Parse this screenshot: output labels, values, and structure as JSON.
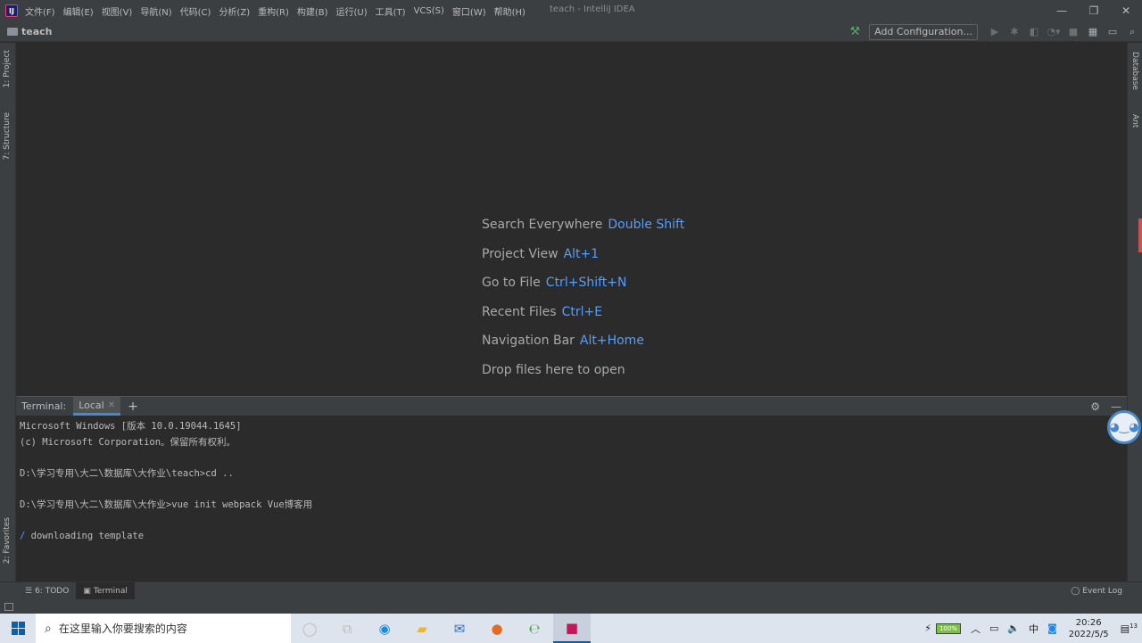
{
  "window": {
    "title": "teach - IntelliJ IDEA",
    "minimize": "—",
    "maximize": "❐",
    "close": "✕"
  },
  "menu": [
    "文件(F)",
    "编辑(E)",
    "视图(V)",
    "导航(N)",
    "代码(C)",
    "分析(Z)",
    "重构(R)",
    "构建(B)",
    "运行(U)",
    "工具(T)",
    "VCS(S)",
    "窗口(W)",
    "帮助(H)"
  ],
  "navbar": {
    "project": "teach",
    "add_configuration": "Add Configuration..."
  },
  "left_tabs": {
    "project": "1: Project",
    "structure": "7: Structure",
    "favorites": "2: Favorites"
  },
  "right_tabs": {
    "database": "Database",
    "ant": "Ant"
  },
  "editor_hints": [
    {
      "label": "Search Everywhere",
      "key": "Double Shift"
    },
    {
      "label": "Project View",
      "key": "Alt+1"
    },
    {
      "label": "Go to File",
      "key": "Ctrl+Shift+N"
    },
    {
      "label": "Recent Files",
      "key": "Ctrl+E"
    },
    {
      "label": "Navigation Bar",
      "key": "Alt+Home"
    },
    {
      "label": "Drop files here to open",
      "key": ""
    }
  ],
  "terminal": {
    "label": "Terminal:",
    "tab": "Local",
    "lines": [
      "Microsoft Windows [版本 10.0.19044.1645]",
      "(c) Microsoft Corporation。保留所有权利。",
      "",
      "D:\\学习专用\\大二\\数据库\\大作业\\teach>cd ..",
      "",
      "D:\\学习专用\\大二\\数据库\\大作业>vue init webpack Vue博客用",
      ""
    ],
    "spinner": "/",
    "progress_line": " downloading template"
  },
  "bottom_tabs": {
    "todo": "6: TODO",
    "terminal": "Terminal",
    "event_log": "Event Log"
  },
  "taskbar": {
    "search_placeholder": "在这里输入你要搜索的内容",
    "battery": "100%",
    "ime": "中",
    "time": "20:26",
    "date": "2022/5/5",
    "notifications": "13"
  }
}
